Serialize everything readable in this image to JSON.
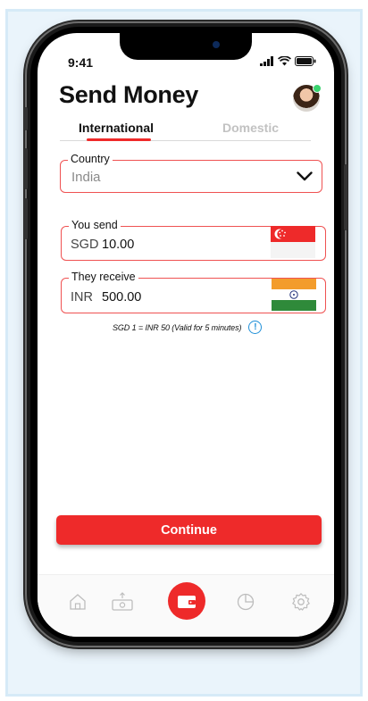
{
  "status_bar": {
    "time": "9:41"
  },
  "header": {
    "title": "Send Money"
  },
  "tabs": [
    {
      "label": "International",
      "active": true
    },
    {
      "label": "Domestic",
      "active": false
    }
  ],
  "country": {
    "label": "Country",
    "value": "India"
  },
  "send": {
    "label": "You send",
    "currency": "SGD",
    "amount": "10.00"
  },
  "receive": {
    "label": "They receive",
    "currency": "INR",
    "amount": "500.00"
  },
  "rate": {
    "text": "SGD 1 = INR 50 (Valid for 5 minutes)"
  },
  "actions": {
    "continue_label": "Continue"
  },
  "nav": {
    "items": [
      "home-icon",
      "cash-icon",
      "wallet-icon",
      "pie-chart-icon",
      "settings-icon"
    ],
    "active": "wallet-icon"
  },
  "colors": {
    "accent": "#ee2a2a",
    "info": "#1e8fd8",
    "tab_inactive": "#c2c2c2"
  }
}
